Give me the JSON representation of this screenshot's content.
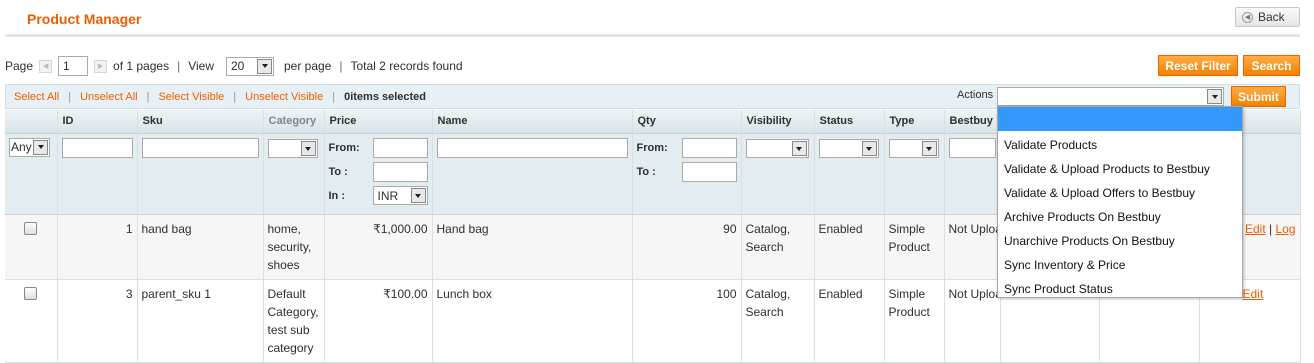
{
  "header": {
    "title": "Product Manager",
    "back_label": "Back"
  },
  "pager": {
    "page_label": "Page",
    "page_value": "1",
    "of_pages": "of 1 pages",
    "view_label": "View",
    "view_value": "20",
    "per_page": "per page",
    "total": "Total 2 records found"
  },
  "buttons": {
    "reset_filter": "Reset Filter",
    "search": "Search",
    "submit": "Submit"
  },
  "massaction": {
    "select_all": "Select All",
    "unselect_all": "Unselect All",
    "select_visible": "Select Visible",
    "unselect_visible": "Unselect Visible",
    "selected_count": "0",
    "selected_suffix": " items selected",
    "actions_label": "Actions",
    "actions_value": ""
  },
  "columns": {
    "id": "ID",
    "sku": "Sku",
    "category": "Category",
    "price": "Price",
    "name": "Name",
    "qty": "Qty",
    "visibility": "Visibility",
    "status": "Status",
    "type": "Type",
    "bestbuy": "Bestbuy"
  },
  "filters": {
    "any": "Any",
    "from": "From:",
    "to": "To :",
    "in": "In :",
    "currency": "INR"
  },
  "rows": [
    {
      "id": "1",
      "sku": "hand bag",
      "category": "home, security, shoes",
      "price": "₹1,000.00",
      "name": "Hand bag",
      "qty": "90",
      "visibility": "Catalog, Search",
      "status": "Enabled",
      "type": "Simple Product",
      "bestbuy": "Not Uploaded",
      "edit": "Edit",
      "log": "Log"
    },
    {
      "id": "3",
      "sku": "parent_sku 1",
      "category": "Default Category, test sub category",
      "price": "₹100.00",
      "name": "Lunch box",
      "qty": "100",
      "visibility": "Catalog, Search",
      "status": "Enabled",
      "type": "Simple Product",
      "bestbuy": "Not Uploaded",
      "edit": "Edit"
    }
  ],
  "actions_menu": [
    "Validate Products",
    "Validate & Upload Products to Bestbuy",
    "Validate & Upload Offers to Bestbuy",
    "Archive Products On Bestbuy",
    "Unarchive Products On Bestbuy",
    "Sync Inventory & Price",
    "Sync Product Status"
  ],
  "colors": {
    "accent": "#eb5e00",
    "button": "#f18200",
    "highlight": "#3399ff"
  }
}
